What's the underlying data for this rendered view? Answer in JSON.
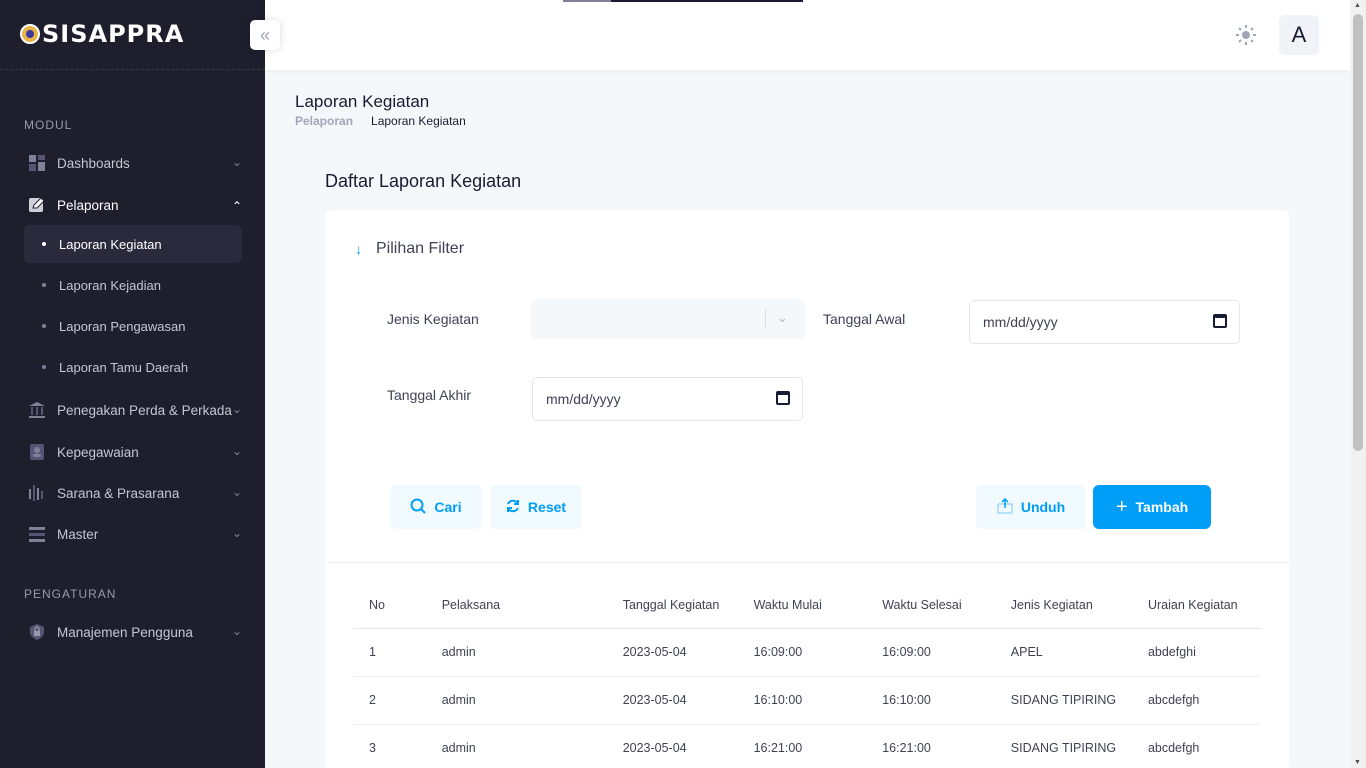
{
  "app": {
    "name": "SISAPPRA"
  },
  "sidebar": {
    "section_modul": "MODUL",
    "section_pengaturan": "PENGATURAN",
    "items": [
      {
        "label": "Dashboards",
        "icon": "grid-icon"
      },
      {
        "label": "Pelaporan",
        "icon": "edit-icon"
      },
      {
        "label": "Penegakan Perda & Perkada",
        "icon": "bank-icon"
      },
      {
        "label": "Kepegawaian",
        "icon": "id-card-icon"
      },
      {
        "label": "Sarana & Prasarana",
        "icon": "bars-icon"
      },
      {
        "label": "Master",
        "icon": "menu-icon"
      },
      {
        "label": "Manajemen Pengguna",
        "icon": "shield-lock-icon"
      }
    ],
    "sub_items": [
      {
        "label": "Laporan Kegiatan",
        "active": true
      },
      {
        "label": "Laporan Kejadian"
      },
      {
        "label": "Laporan Pengawasan"
      },
      {
        "label": "Laporan Tamu Daerah"
      }
    ]
  },
  "header": {
    "avatar_initial": "A"
  },
  "page": {
    "title": "Laporan Kegiatan",
    "breadcrumb": [
      "Pelaporan",
      "Laporan Kegiatan"
    ],
    "card_title": "Daftar Laporan Kegiatan"
  },
  "filter": {
    "title": "Pilihan Filter",
    "jenis_label": "Jenis Kegiatan",
    "tgl_awal_label": "Tanggal Awal",
    "tgl_akhir_label": "Tanggal Akhir",
    "date_placeholder": "mm/dd/yyyy"
  },
  "buttons": {
    "cari": "Cari",
    "reset": "Reset",
    "unduh": "Unduh",
    "tambah": "Tambah"
  },
  "colors": {
    "primary": "#009ef7",
    "sidebar": "#1e1e2d"
  },
  "table": {
    "headers": [
      "No",
      "Pelaksana",
      "Tanggal Kegiatan",
      "Waktu Mulai",
      "Waktu Selesai",
      "Jenis Kegiatan",
      "Uraian Kegiatan"
    ],
    "rows": [
      [
        "1",
        "admin",
        "2023-05-04",
        "16:09:00",
        "16:09:00",
        "APEL",
        "abdefghi"
      ],
      [
        "2",
        "admin",
        "2023-05-04",
        "16:10:00",
        "16:10:00",
        "SIDANG TIPIRING",
        "abcdefgh"
      ],
      [
        "3",
        "admin",
        "2023-05-04",
        "16:21:00",
        "16:21:00",
        "SIDANG TIPIRING",
        "abcdefgh"
      ]
    ]
  }
}
